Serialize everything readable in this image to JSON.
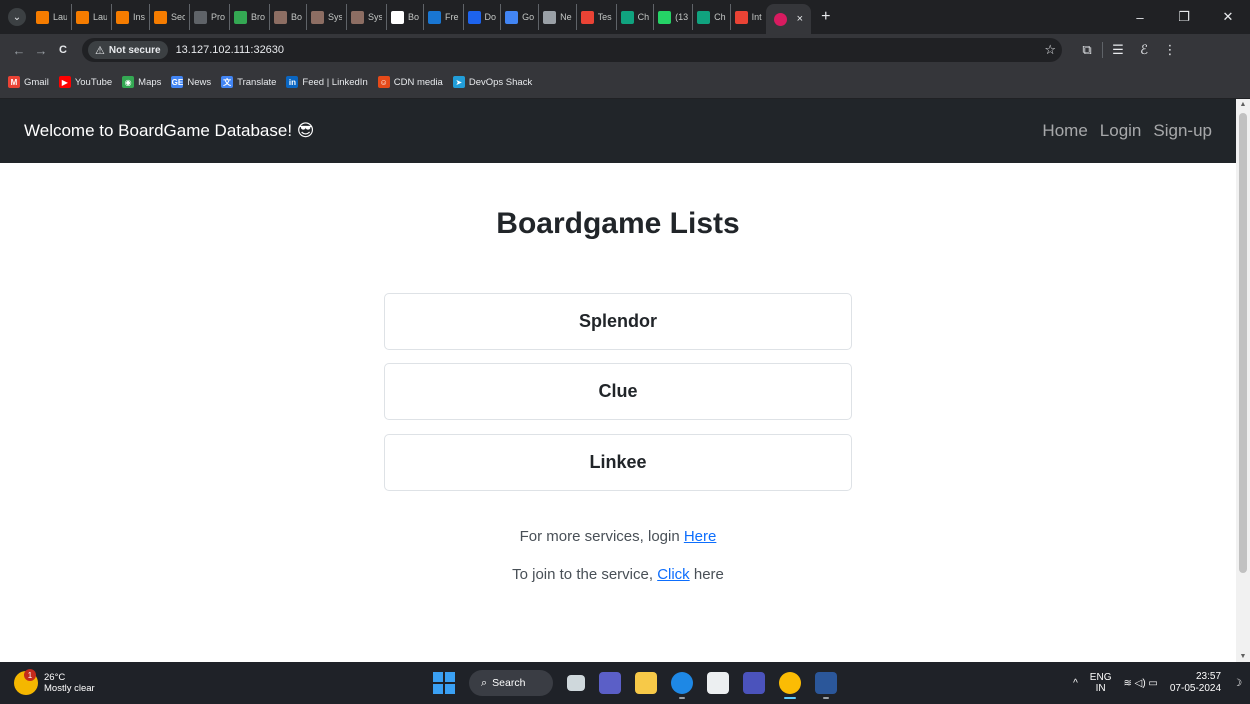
{
  "browser": {
    "tabs": [
      {
        "title": "Lau",
        "icon": "orange-app-icon",
        "color": "#f57c00"
      },
      {
        "title": "Lau",
        "icon": "orange-app-icon",
        "color": "#f57c00"
      },
      {
        "title": "Ins",
        "icon": "orange-app-icon",
        "color": "#f57c00"
      },
      {
        "title": "Sec",
        "icon": "orange-app-icon",
        "color": "#f57c00"
      },
      {
        "title": "Pro",
        "icon": "curve-icon",
        "color": "#5f6368"
      },
      {
        "title": "Bro",
        "icon": "leaf-icon",
        "color": "#34a853"
      },
      {
        "title": "Bo",
        "icon": "avatar-icon",
        "color": "#8d6e63"
      },
      {
        "title": "Sys",
        "icon": "avatar-icon",
        "color": "#8d6e63"
      },
      {
        "title": "Sys",
        "icon": "avatar-icon",
        "color": "#8d6e63"
      },
      {
        "title": "Bo",
        "icon": "github-icon",
        "color": "#ffffff"
      },
      {
        "title": "Fre",
        "icon": "save-icon",
        "color": "#1976d2"
      },
      {
        "title": "Do",
        "icon": "docker-icon",
        "color": "#1d63ed"
      },
      {
        "title": "Go",
        "icon": "google-icon",
        "color": "#4285f4"
      },
      {
        "title": "Ne",
        "icon": "chrome-icon",
        "color": "#9aa0a6"
      },
      {
        "title": "Tes",
        "icon": "gmail-icon",
        "color": "#ea4335"
      },
      {
        "title": "Ch",
        "icon": "chatgpt-icon",
        "color": "#10a37f"
      },
      {
        "title": "(13",
        "icon": "whatsapp-icon",
        "color": "#25d366"
      },
      {
        "title": "Ch",
        "icon": "chatgpt-icon",
        "color": "#10a37f"
      },
      {
        "title": "Int",
        "icon": "gmail-icon",
        "color": "#ea4335"
      }
    ],
    "active_tab": {
      "icon": "boardgame-icon",
      "color": "#d81b60",
      "close": "×"
    },
    "new_tab": "+",
    "window_controls": {
      "minimize": "–",
      "restore": "❐",
      "close": "✕"
    },
    "nav": {
      "back": "←",
      "forward": "→",
      "reload": "C"
    },
    "security_chip": "Not secure",
    "security_warn_glyph": "⚠",
    "url": "13.127.102.111:32630",
    "star": "☆",
    "toolbar_icons": {
      "extensions": "⧉",
      "reading_list": "☰",
      "profile": "ℰ",
      "menu": "⋮"
    },
    "bookmarks": [
      {
        "label": "Gmail",
        "icon": "gmail-icon",
        "color": "#ea4335",
        "glyph": "M"
      },
      {
        "label": "YouTube",
        "icon": "youtube-icon",
        "color": "#ff0000",
        "glyph": "▶"
      },
      {
        "label": "Maps",
        "icon": "maps-icon",
        "color": "#34a853",
        "glyph": "◉"
      },
      {
        "label": "News",
        "icon": "news-icon",
        "color": "#4285f4",
        "glyph": "GE"
      },
      {
        "label": "Translate",
        "icon": "translate-icon",
        "color": "#4285f4",
        "glyph": "文"
      },
      {
        "label": "Feed | LinkedIn",
        "icon": "linkedin-icon",
        "color": "#0a66c2",
        "glyph": "in"
      },
      {
        "label": "CDN media",
        "icon": "cdn-icon",
        "color": "#e64a19",
        "glyph": "☺"
      },
      {
        "label": "DevOps Shack",
        "icon": "telegram-icon",
        "color": "#229ed9",
        "glyph": "➤"
      }
    ]
  },
  "site": {
    "brand": "Welcome to BoardGame Database! 😎",
    "nav_links": [
      "Home",
      "Login",
      "Sign-up"
    ],
    "title": "Boardgame Lists",
    "games": [
      "Splendor",
      "Clue",
      "Linkee"
    ],
    "login_prefix": "For more services, login ",
    "login_link": "Here",
    "join_prefix": "To join to the service, ",
    "join_link": "Click",
    "join_suffix": " here"
  },
  "scrollbar": {
    "up": "▲",
    "down": "▼"
  },
  "taskbar": {
    "weather_temp": "26°C",
    "weather_desc": "Mostly clear",
    "weather_badge": "1",
    "search_label": "Search",
    "search_glyph": "⌕",
    "tray_arrow": "^",
    "lang_top": "ENG",
    "lang_bottom": "IN",
    "tray_icons": "≋ ◁) ▭",
    "time": "23:57",
    "date": "07-05-2024",
    "notification_glyph": "☽"
  }
}
